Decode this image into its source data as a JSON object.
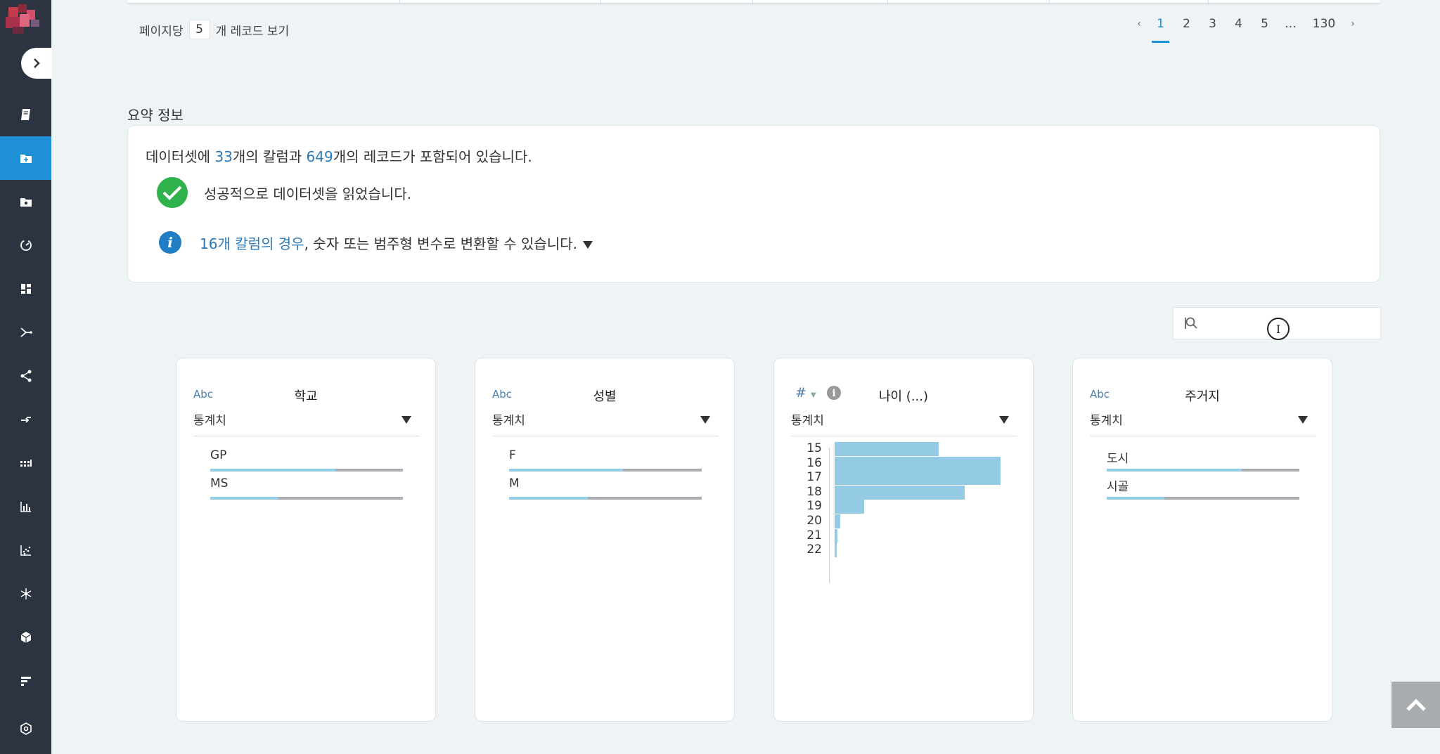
{
  "pagination": {
    "per_page_prefix": "페이지당",
    "per_page_value": "5",
    "per_page_suffix": "개 레코드 보기",
    "prev": "‹",
    "pages": [
      "1",
      "2",
      "3",
      "4",
      "5",
      "...",
      "130"
    ],
    "active_page": "1",
    "next": "›"
  },
  "summary": {
    "section_title": "요약 정보",
    "line_prefix": "데이터셋에 ",
    "column_count": "33",
    "line_mid": "개의 칼럼과 ",
    "record_count": "649",
    "line_suffix": "개의 레코드가 포함되어 있습니다.",
    "success_message": "성공적으로 데이터셋을 읽었습니다.",
    "info_link": "16개 칼럼의 경우",
    "info_text": ", 숫자 또는 범주형 변수로 변환할 수 있습니다."
  },
  "search": {
    "placeholder": ""
  },
  "cards": [
    {
      "type": "Abc",
      "title": "학교",
      "stat_label": "통계치",
      "categories": [
        {
          "label": "GP",
          "fraction": 0.65
        },
        {
          "label": "MS",
          "fraction": 0.35
        }
      ]
    },
    {
      "type": "Abc",
      "title": "성별",
      "stat_label": "통계치",
      "categories": [
        {
          "label": "F",
          "fraction": 0.59
        },
        {
          "label": "M",
          "fraction": 0.41
        }
      ]
    },
    {
      "type": "#",
      "title": "나이 (...)",
      "stat_label": "통계치",
      "histogram": {
        "labels": [
          "15",
          "16",
          "17",
          "18",
          "19",
          "20",
          "21",
          "22"
        ],
        "values": [
          112,
          179,
          179,
          140,
          32,
          6,
          3,
          0
        ]
      }
    },
    {
      "type": "Abc",
      "title": "주거지",
      "stat_label": "통계치",
      "categories": [
        {
          "label": "도시",
          "fraction": 0.7
        },
        {
          "label": "시골",
          "fraction": 0.3
        }
      ]
    }
  ],
  "colors": {
    "sidebar": "#2b3440",
    "active": "#1f8fd6",
    "link": "#2a7ab8",
    "bar_fill": "#92cbe3",
    "bar_rest": "#a9adb1",
    "success": "#2fb24c"
  }
}
